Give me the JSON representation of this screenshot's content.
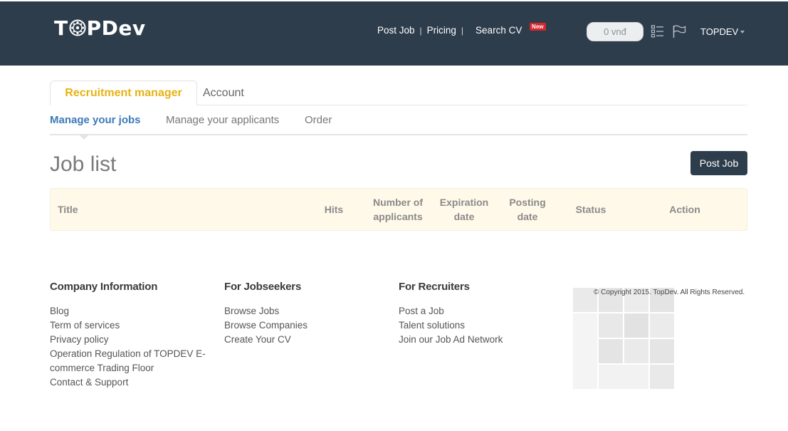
{
  "header": {
    "logo_text_before": "T",
    "logo_text_after": "PDev",
    "nav": [
      {
        "label": "Post Job"
      },
      {
        "label": "Pricing"
      },
      {
        "label": "Search CV"
      }
    ],
    "new_badge": "New",
    "balance": "0 vnđ",
    "user_name": "TOPDEV",
    "colors": {
      "header_bg": "#2e3d4c",
      "badge": "#d7262e"
    }
  },
  "tabs": {
    "recruitment_manager": "Recruitment manager",
    "account": "Account"
  },
  "subnav": {
    "manage_jobs": "Manage your jobs",
    "manage_applicants": "Manage your applicants",
    "order": "Order"
  },
  "main": {
    "title": "Job list",
    "post_job_button": "Post Job",
    "table_headers": {
      "title": "Title",
      "hits": "Hits",
      "applicants_line1": "Number of",
      "applicants_line2": "applicants",
      "expiration_line1": "Expiration",
      "expiration_line2": "date",
      "posting_line1": "Posting",
      "posting_line2": "date",
      "status": "Status",
      "action": "Action"
    }
  },
  "footer": {
    "company": {
      "heading": "Company Information",
      "links": [
        "Blog",
        "Term of services",
        "Privacy policy",
        "Operation Regulation of TOPDEV E-commerce Trading Floor",
        "Contact & Support"
      ]
    },
    "jobseekers": {
      "heading": "For Jobseekers",
      "links": [
        "Browse Jobs",
        "Browse Companies",
        "Create Your CV"
      ]
    },
    "recruiters": {
      "heading": "For Recruiters",
      "links": [
        "Post a Job",
        "Talent solutions",
        "Join our Job Ad Network"
      ]
    },
    "copyright": "© Copyright 2015. TopDev. All Rights Reserved."
  }
}
